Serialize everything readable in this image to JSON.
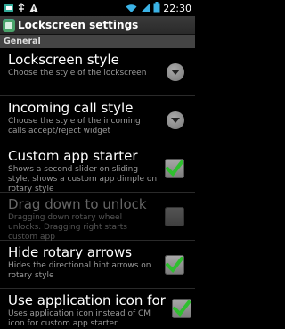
{
  "status_bar": {
    "time": "22:30"
  },
  "title_bar": {
    "title": "Lockscreen settings"
  },
  "section": {
    "label": "General"
  },
  "prefs": [
    {
      "title": "Lockscreen style",
      "summary": "Choose the style of the lockscreen"
    },
    {
      "title": "Incoming call style",
      "summary": "Choose the style of the incoming calls accept/reject widget"
    },
    {
      "title": "Custom app starter",
      "summary": "Shows a second slider on sliding style, shows a custom app dimple on rotary style",
      "checked": true
    },
    {
      "title": "Drag down to unlock",
      "summary": "Dragging down rotary wheel unlocks. Dragging right starts custom app",
      "enabled": false,
      "checked": false
    },
    {
      "title": "Hide rotary arrows",
      "summary": "Hides the directional hint arrows on rotary style",
      "checked": true
    },
    {
      "title": "Use application icon for",
      "summary": "Uses application icon instead of CM icon for custom app starter",
      "checked": true
    }
  ],
  "colors": {
    "check_green": "#2fbf2f",
    "section_bg": "#444444"
  }
}
